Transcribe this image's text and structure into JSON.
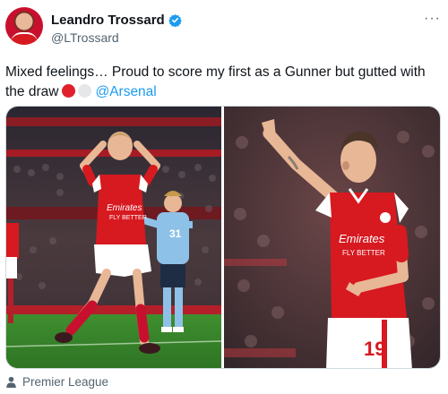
{
  "author": {
    "display_name": "Leandro Trossard",
    "handle": "@LTrossard",
    "verified_icon": "verified-badge-icon",
    "avatar_icon": "avatar"
  },
  "more_icon": "more-options-icon",
  "more_label": "···",
  "tweet": {
    "text": "Mixed feelings… Proud to score my first as a Gunner but gutted with the draw",
    "emojis": [
      "red-circle",
      "white-circle"
    ],
    "mention": "@Arsenal"
  },
  "media": {
    "photos": [
      "celebration-photo",
      "appeal-photo"
    ],
    "left_photo": {
      "shirt_sponsor": "Emirates FLY BETTER",
      "opponent_number": "31"
    },
    "right_photo": {
      "shirt_sponsor": "Emirates FLY BETTER",
      "shorts_number": "19"
    }
  },
  "footer": {
    "icon": "person-icon",
    "label": "Premier League"
  },
  "colors": {
    "accent": "#1d9bf0",
    "arsenal_red": "#d71920",
    "secondary_text": "#536471"
  }
}
